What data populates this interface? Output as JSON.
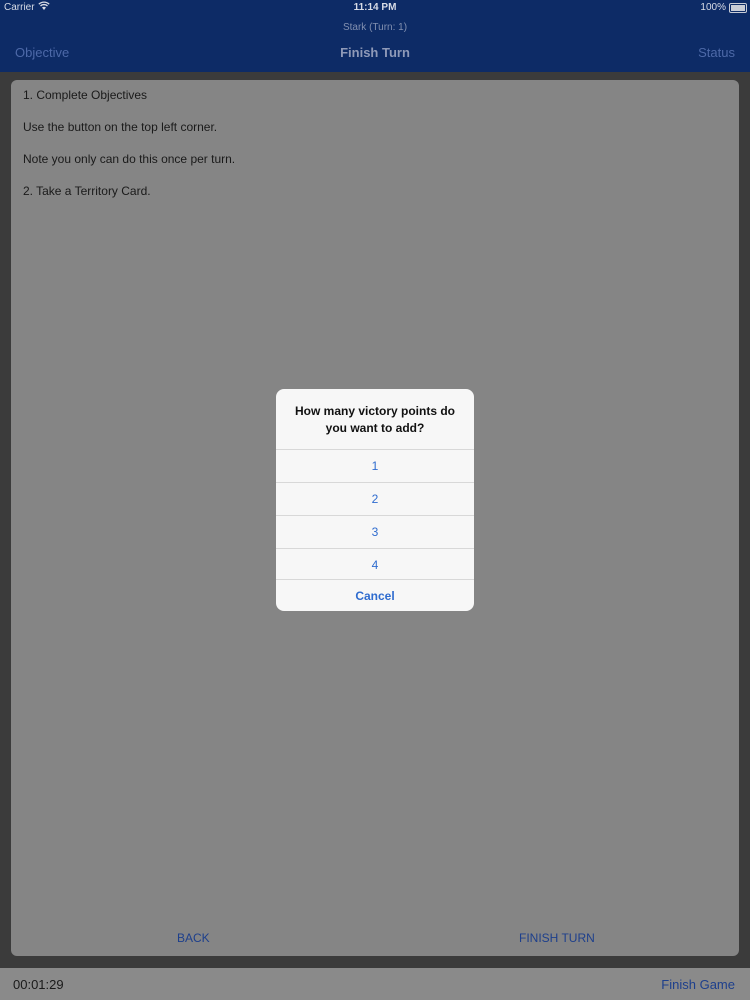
{
  "status_bar": {
    "carrier": "Carrier",
    "time": "11:14 PM",
    "battery": "100%"
  },
  "nav": {
    "subtitle": "Stark (Turn: 1)",
    "title": "Finish Turn",
    "left": "Objective",
    "right": "Status"
  },
  "content": {
    "lines": [
      "1. Complete Objectives",
      "Use the button on the top left corner.",
      "Note you only can do this once per turn.",
      "2. Take a Territory Card."
    ],
    "back_label": "BACK",
    "finish_turn_label": "FINISH TURN"
  },
  "footer": {
    "timer": "00:01:29",
    "finish_game": "Finish Game"
  },
  "alert": {
    "title": "How many victory points do you want to add?",
    "options": [
      "1",
      "2",
      "3",
      "4"
    ],
    "cancel": "Cancel"
  },
  "colors": {
    "nav_bg": "#0d2b66",
    "accent": "#2f6ccf",
    "dim_bg": "#808080"
  }
}
